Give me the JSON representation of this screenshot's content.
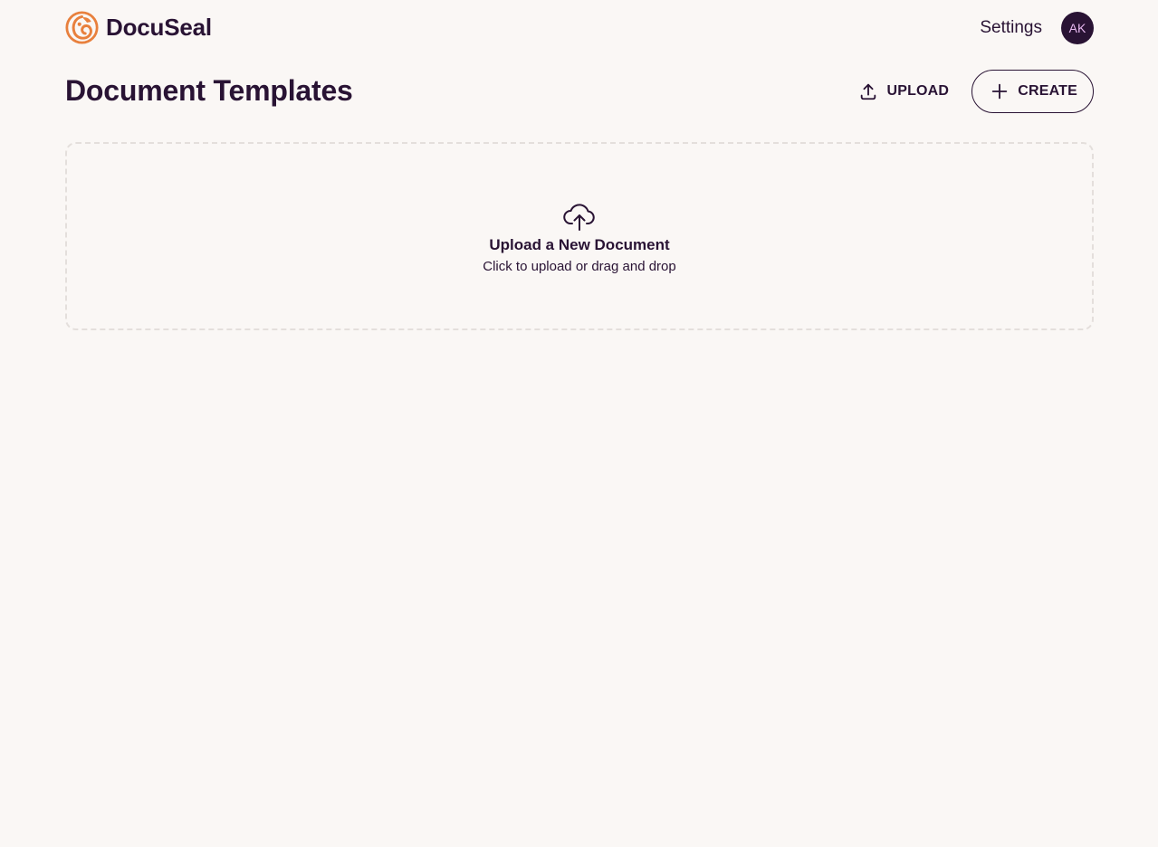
{
  "header": {
    "brand_name": "DocuSeal",
    "settings_label": "Settings",
    "avatar_initials": "AK"
  },
  "main": {
    "title": "Document Templates",
    "upload_label": "UPLOAD",
    "create_label": "CREATE",
    "dropzone": {
      "title": "Upload a New Document",
      "subtitle": "Click to upload or drag and drop"
    }
  },
  "colors": {
    "background": "#faf7f5",
    "text": "#291334",
    "brand_accent": "#e8803d",
    "dropzone_border": "#e4dfdc",
    "avatar_text": "#e7b8f0"
  },
  "icons": {
    "logo": "docuseal-logo-icon",
    "upload": "upload-icon",
    "create": "plus-icon",
    "dropzone": "cloud-upload-icon"
  }
}
